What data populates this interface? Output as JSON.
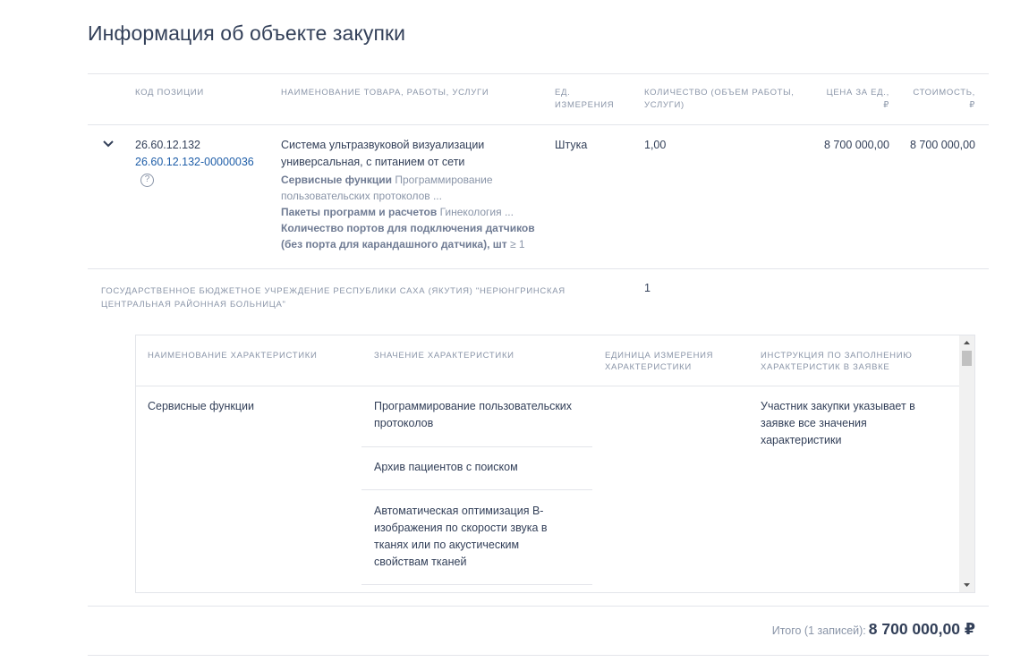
{
  "page": {
    "title": "Информация об объекте закупки"
  },
  "table": {
    "headers": {
      "code": "КОД ПОЗИЦИИ",
      "name": "НАИМЕНОВАНИЕ ТОВАРА, РАБОТЫ, УСЛУГИ",
      "unit_1": "ЕД.",
      "unit_2": "ИЗМЕРЕНИЯ",
      "qty_1": "КОЛИЧЕСТВО (ОБЪЕМ РАБОТЫ,",
      "qty_2": "УСЛУГИ)",
      "price_1": "ЦЕНА ЗА ЕД.,",
      "price_2": "₽",
      "cost_1": "СТОИМОСТЬ,",
      "cost_2": "₽"
    },
    "row": {
      "code": "26.60.12.132",
      "code_link": "26.60.12.132-00000036",
      "help_glyph": "?",
      "name_1": "Система ультразвуковой визуализации",
      "name_2": "универсальная, с питанием от сети",
      "char1_label": "Сервисные функции",
      "char1_value": " Программирование пользовательских протоколов ...",
      "char2_label": "Пакеты программ и расчетов",
      "char2_value": " Гинекология ...",
      "char3_label": "Количество портов для подключения датчиков (без порта для карандашного датчика), шт",
      "char3_value": " ≥ 1",
      "unit": "Штука",
      "qty": "1,00",
      "price": "8 700 000,00",
      "cost": "8 700 000,00"
    },
    "customer": {
      "name": "ГОСУДАРСТВЕННОЕ БЮДЖЕТНОЕ УЧРЕЖДЕНИЕ РЕСПУБЛИКИ САХА (ЯКУТИЯ) \"НЕРЮНГРИНСКАЯ ЦЕНТРАЛЬНАЯ РАЙОННАЯ БОЛЬНИЦА\"",
      "qty": "1"
    }
  },
  "characteristics": {
    "headers": {
      "name": "НАИМЕНОВАНИЕ ХАРАКТЕРИСТИКИ",
      "value": "ЗНАЧЕНИЕ ХАРАКТЕРИСТИКИ",
      "unit_1": "ЕДИНИЦА ИЗМЕРЕНИЯ",
      "unit_2": "ХАРАКТЕРИСТИКИ",
      "instr_1": "ИНСТРУКЦИЯ ПО ЗАПОЛНЕНИЮ",
      "instr_2": "ХАРАКТЕРИСТИК В ЗАЯВКЕ"
    },
    "row": {
      "name": "Сервисные функции",
      "values": [
        "Программирование пользовательских протоколов",
        "Архив пациентов с поиском",
        "Автоматическая оптимизация B-изображения по скорости звука в тканях или по акустическим свойствам тканей"
      ],
      "instruction": "Участник закупки указывает в заявке все значения характеристики"
    }
  },
  "footer": {
    "total_label": "Итого (1 записей):",
    "total_value": "8 700 000,00 ₽"
  },
  "icons": {
    "expand": "chevron-down-icon",
    "help": "question-circle-icon",
    "scroll_up": "triangle-up-icon",
    "scroll_down": "triangle-down-icon"
  },
  "colors": {
    "link": "#1f5ea8",
    "text": "#334059",
    "muted": "#8a95a8",
    "divider": "#e3e5ea"
  }
}
